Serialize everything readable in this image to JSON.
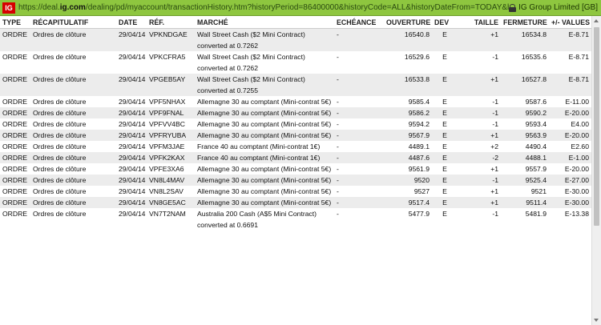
{
  "address_bar": {
    "logo": "IG",
    "url_prefix": "https://deal.",
    "url_domain": "ig.com",
    "url_rest": "/dealing/pd/myaccount/transactionHistory.htm?historyPeriod=86400000&historyCode=ALL&historyDateFrom=TODAY&historyDateTo=&transact",
    "certificate": "IG Group Limited [GB]"
  },
  "table": {
    "headers": [
      "TYPE",
      "RÉCAPITULATIF",
      "DATE",
      "RÉF.",
      "MARCHÉ",
      "ECHÉANCE",
      "OUVERTURE",
      "DEV",
      "TAILLE",
      "FERMETURE",
      "+/- VALUES"
    ],
    "rows": [
      {
        "type": "ORDRE",
        "summary": "Ordres de clôture",
        "date": "29/04/14",
        "ref": "VPKNDGAE",
        "market": "Wall Street Cash ($2 Mini Contract) converted at 0.7262",
        "expiry": "-",
        "open": "16540.8",
        "dev": "E",
        "size": "+1",
        "close": "16534.8",
        "pl": "E-8.71"
      },
      {
        "type": "ORDRE",
        "summary": "Ordres de clôture",
        "date": "29/04/14",
        "ref": "VPKCFRA5",
        "market": "Wall Street Cash ($2 Mini Contract) converted at 0.7262",
        "expiry": "-",
        "open": "16529.6",
        "dev": "E",
        "size": "-1",
        "close": "16535.6",
        "pl": "E-8.71"
      },
      {
        "type": "ORDRE",
        "summary": "Ordres de clôture",
        "date": "29/04/14",
        "ref": "VPGEB5AY",
        "market": "Wall Street Cash ($2 Mini Contract) converted at 0.7255",
        "expiry": "-",
        "open": "16533.8",
        "dev": "E",
        "size": "+1",
        "close": "16527.8",
        "pl": "E-8.71"
      },
      {
        "type": "ORDRE",
        "summary": "Ordres de clôture",
        "date": "29/04/14",
        "ref": "VPF5NHAX",
        "market": "Allemagne 30 au comptant (Mini-contrat 5€)",
        "expiry": "-",
        "open": "9585.4",
        "dev": "E",
        "size": "-1",
        "close": "9587.6",
        "pl": "E-11.00"
      },
      {
        "type": "ORDRE",
        "summary": "Ordres de clôture",
        "date": "29/04/14",
        "ref": "VPF9FNAL",
        "market": "Allemagne 30 au comptant (Mini-contrat 5€)",
        "expiry": "-",
        "open": "9586.2",
        "dev": "E",
        "size": "-1",
        "close": "9590.2",
        "pl": "E-20.00"
      },
      {
        "type": "ORDRE",
        "summary": "Ordres de clôture",
        "date": "29/04/14",
        "ref": "VPFVV4BC",
        "market": "Allemagne 30 au comptant (Mini-contrat 5€)",
        "expiry": "-",
        "open": "9594.2",
        "dev": "E",
        "size": "-1",
        "close": "9593.4",
        "pl": "E4.00"
      },
      {
        "type": "ORDRE",
        "summary": "Ordres de clôture",
        "date": "29/04/14",
        "ref": "VPFRYUBA",
        "market": "Allemagne 30 au comptant (Mini-contrat 5€)",
        "expiry": "-",
        "open": "9567.9",
        "dev": "E",
        "size": "+1",
        "close": "9563.9",
        "pl": "E-20.00"
      },
      {
        "type": "ORDRE",
        "summary": "Ordres de clôture",
        "date": "29/04/14",
        "ref": "VPFM3JAE",
        "market": "France 40 au comptant (Mini-contrat 1€)",
        "expiry": "-",
        "open": "4489.1",
        "dev": "E",
        "size": "+2",
        "close": "4490.4",
        "pl": "E2.60"
      },
      {
        "type": "ORDRE",
        "summary": "Ordres de clôture",
        "date": "29/04/14",
        "ref": "VPFK2KAX",
        "market": "France 40 au comptant (Mini-contrat 1€)",
        "expiry": "-",
        "open": "4487.6",
        "dev": "E",
        "size": "-2",
        "close": "4488.1",
        "pl": "E-1.00"
      },
      {
        "type": "ORDRE",
        "summary": "Ordres de clôture",
        "date": "29/04/14",
        "ref": "VPFE3XA6",
        "market": "Allemagne 30 au comptant (Mini-contrat 5€)",
        "expiry": "-",
        "open": "9561.9",
        "dev": "E",
        "size": "+1",
        "close": "9557.9",
        "pl": "E-20.00"
      },
      {
        "type": "ORDRE",
        "summary": "Ordres de clôture",
        "date": "29/04/14",
        "ref": "VN8L4MAV",
        "market": "Allemagne 30 au comptant (Mini-contrat 5€)",
        "expiry": "-",
        "open": "9520",
        "dev": "E",
        "size": "-1",
        "close": "9525.4",
        "pl": "E-27.00"
      },
      {
        "type": "ORDRE",
        "summary": "Ordres de clôture",
        "date": "29/04/14",
        "ref": "VN8L2SAV",
        "market": "Allemagne 30 au comptant (Mini-contrat 5€)",
        "expiry": "-",
        "open": "9527",
        "dev": "E",
        "size": "+1",
        "close": "9521",
        "pl": "E-30.00"
      },
      {
        "type": "ORDRE",
        "summary": "Ordres de clôture",
        "date": "29/04/14",
        "ref": "VN8GE5AC",
        "market": "Allemagne 30 au comptant (Mini-contrat 5€)",
        "expiry": "-",
        "open": "9517.4",
        "dev": "E",
        "size": "+1",
        "close": "9511.4",
        "pl": "E-30.00"
      },
      {
        "type": "ORDRE",
        "summary": "Ordres de clôture",
        "date": "29/04/14",
        "ref": "VN7T2NAM",
        "market": "Australia 200 Cash (A$5 Mini Contract) converted at 0.6691",
        "expiry": "-",
        "open": "5477.9",
        "dev": "E",
        "size": "-1",
        "close": "5481.9",
        "pl": "E-13.38"
      }
    ]
  }
}
